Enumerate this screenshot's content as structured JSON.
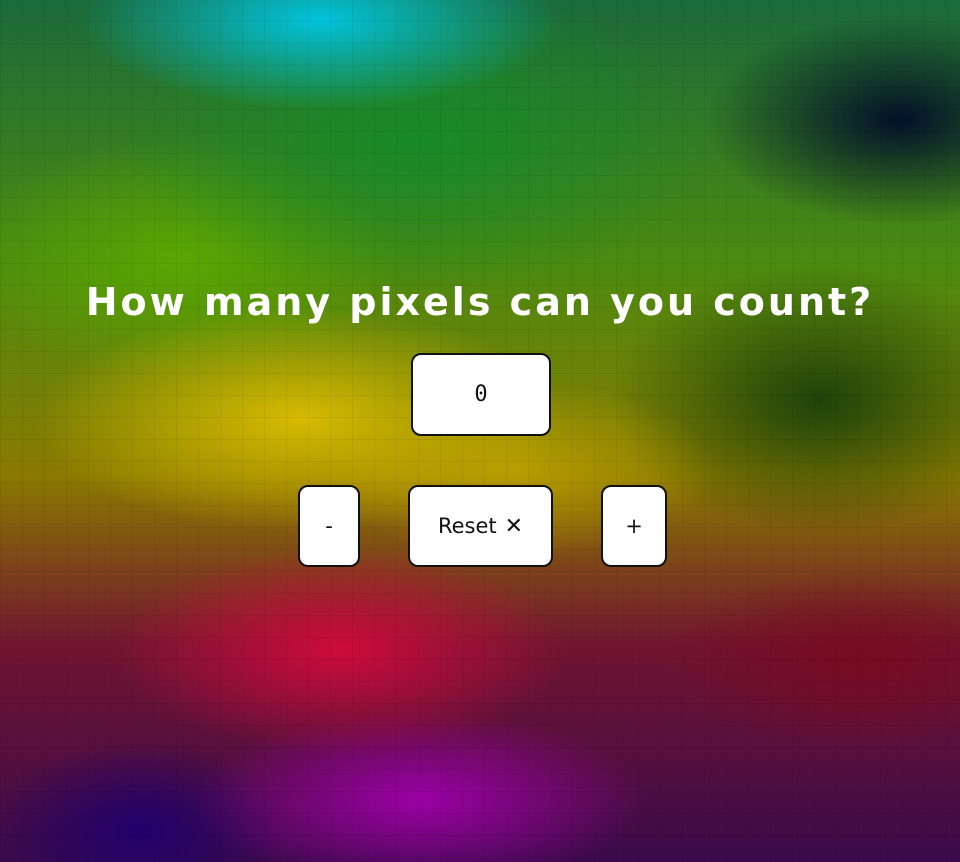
{
  "heading": "How many pixels can you count?",
  "counter": {
    "value": "0"
  },
  "buttons": {
    "decrement_label": "-",
    "reset_label": "Reset",
    "reset_icon": "✕",
    "increment_label": "+"
  },
  "colors": {
    "text": "#ffffff",
    "button_bg": "#ffffff",
    "button_border": "#111111"
  }
}
